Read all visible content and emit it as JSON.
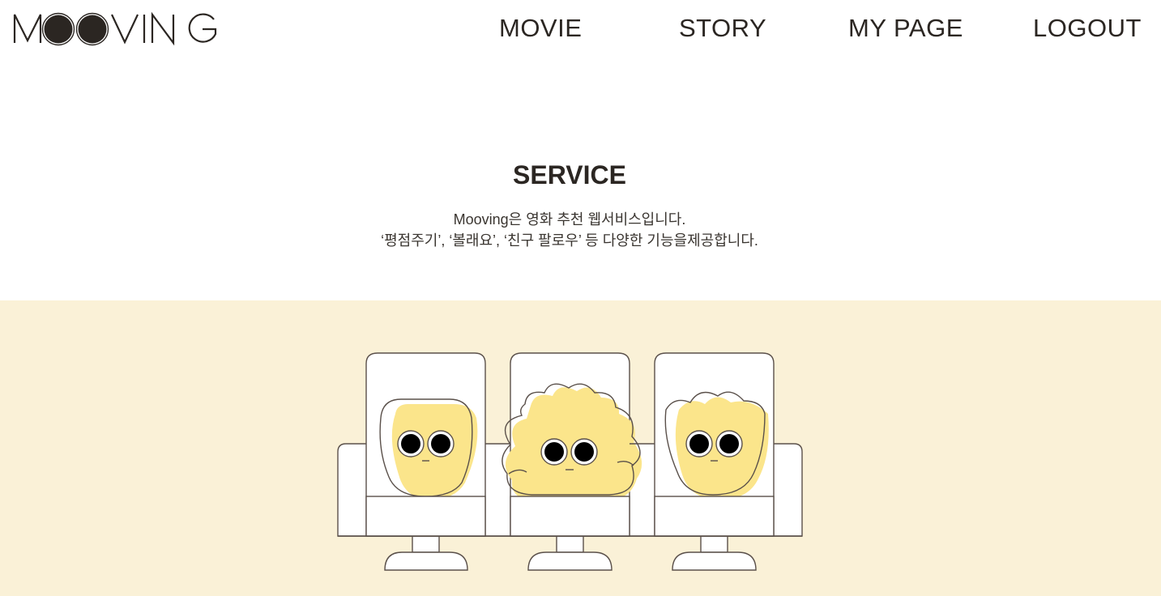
{
  "header": {
    "logo_alt": "MOOVING",
    "nav": {
      "movie": "MOVIE",
      "story": "STORY",
      "mypage": "MY PAGE",
      "logout": "LOGOUT"
    }
  },
  "service": {
    "title": "SERVICE",
    "description_line1": "Mooving은 영화 추천 웹서비스입니다.",
    "description_line2": "‘평점주기’, ‘볼래요’, ‘친구 팔로우’ 등 다양한 기능을제공합니다."
  },
  "colors": {
    "text": "#2b2622",
    "banner_background": "#faf1d7",
    "character_fill": "#fbe58b",
    "seat_fill": "#ffffff",
    "outline": "#5a504a"
  },
  "illustration": {
    "icons": [
      "theater-seat-icon",
      "popcorn-character-icon"
    ]
  }
}
